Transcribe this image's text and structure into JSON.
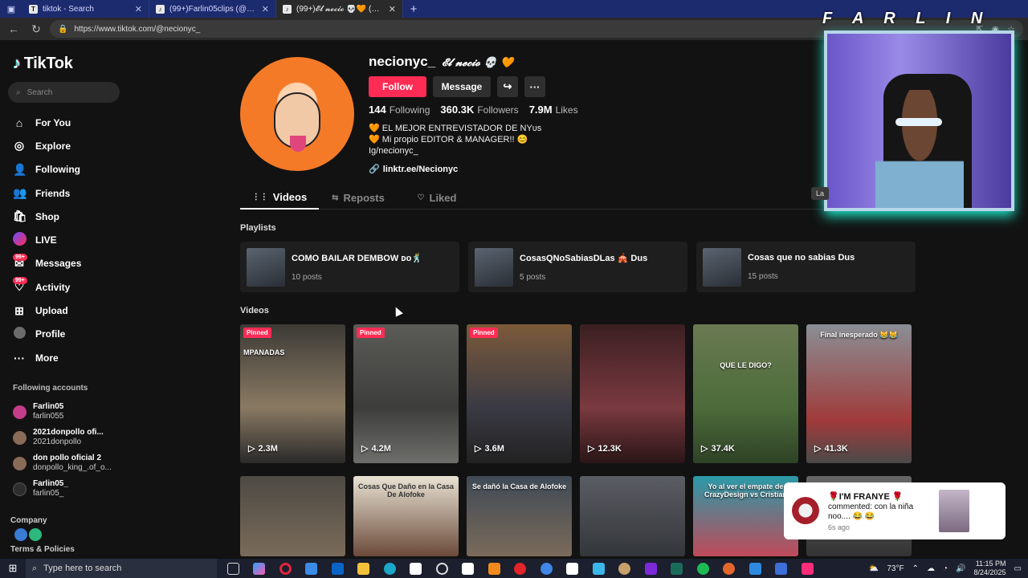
{
  "browser": {
    "tabs": [
      {
        "title": "tiktok - Search",
        "icon": "T",
        "active": false
      },
      {
        "title": "(99+)Farlin05clips (@farlin05clips)",
        "icon": "♪",
        "active": false
      },
      {
        "title": "(99+)𝓔𝓵 𝓷𝓮𝓬𝓲𝓸 💀🧡 (@necionyc_)",
        "icon": "♪",
        "active": true
      }
    ],
    "url": "https://www.tiktok.com/@necionyc_"
  },
  "sidebar": {
    "logo": "TikTok",
    "search_placeholder": "Search",
    "menu": [
      {
        "label": "For You",
        "icon": "home-icon",
        "glyph": "⌂"
      },
      {
        "label": "Explore",
        "icon": "compass-icon",
        "glyph": "◎"
      },
      {
        "label": "Following",
        "icon": "following-icon",
        "glyph": "👤"
      },
      {
        "label": "Friends",
        "icon": "friends-icon",
        "glyph": "👥"
      },
      {
        "label": "Shop",
        "icon": "shop-icon",
        "glyph": "🛍"
      },
      {
        "label": "LIVE",
        "icon": "live-icon",
        "glyph": ""
      },
      {
        "label": "Messages",
        "icon": "messages-icon",
        "glyph": "✉",
        "badge": "99+"
      },
      {
        "label": "Activity",
        "icon": "activity-icon",
        "glyph": "♡",
        "badge": "99+"
      },
      {
        "label": "Upload",
        "icon": "upload-icon",
        "glyph": "⊞"
      },
      {
        "label": "Profile",
        "icon": "profile-icon",
        "glyph": ""
      },
      {
        "label": "More",
        "icon": "more-icon",
        "glyph": "···"
      }
    ],
    "following_title": "Following accounts",
    "following": [
      {
        "name": "Farlin05",
        "handle": "farlin055"
      },
      {
        "name": "2021donpollo ofi...",
        "handle": "2021donpollo"
      },
      {
        "name": "don pollo oficial 2",
        "handle": "donpollo_king_.of_o..."
      },
      {
        "name": "Farlin05_",
        "handle": "farlin05_"
      }
    ],
    "company": "Company",
    "terms": "Terms & Policies"
  },
  "profile": {
    "username": "necionyc_",
    "nickname": "𝓔𝓵 𝓷𝓮𝓬𝓲𝓸 💀 🧡",
    "follow_label": "Follow",
    "message_label": "Message",
    "stats": [
      {
        "value": "144",
        "label": "Following"
      },
      {
        "value": "360.3K",
        "label": "Followers"
      },
      {
        "value": "7.9M",
        "label": "Likes"
      }
    ],
    "bio": [
      "🧡 EL MEJOR ENTREVISTADOR DE NYᴜs",
      "🧡 Mi propio EDITOR & MANAGER!! 😊",
      "Ig/necionyc_"
    ],
    "link": "linktr.ee/Necionyc",
    "tabs": [
      {
        "label": "Videos",
        "icon": "grid-icon",
        "glyph": "⋮⋮"
      },
      {
        "label": "Reposts",
        "icon": "repost-icon",
        "glyph": "⇆"
      },
      {
        "label": "Liked",
        "icon": "heart-icon",
        "glyph": "♡"
      }
    ]
  },
  "playlists_title": "Playlists",
  "playlists": [
    {
      "name": "COMO BAILAR DEMBOW ᴅᴏ🕺",
      "count": "10 posts"
    },
    {
      "name": "CosasQNoSabiasDLas 🎪 Dus",
      "count": "5 posts"
    },
    {
      "name": "Cosas que no sabias Dus",
      "count": "15 posts"
    }
  ],
  "videos_title": "Videos",
  "videos": [
    {
      "views": "2.3M",
      "pinned": "Pinned",
      "caption": "MPANADAS"
    },
    {
      "views": "4.2M",
      "pinned": "Pinned",
      "caption": ""
    },
    {
      "views": "3.6M",
      "pinned": "Pinned",
      "caption": ""
    },
    {
      "views": "12.3K",
      "pinned": "",
      "caption": ""
    },
    {
      "views": "37.4K",
      "pinned": "",
      "caption": "QUE LE DIGO?"
    },
    {
      "views": "41.3K",
      "pinned": "",
      "caption": "Final inesperado 😹😹"
    }
  ],
  "videos_row2": [
    {
      "caption": ""
    },
    {
      "caption": "Cosas Que Daño en la Casa De Alofoke"
    },
    {
      "caption": "Se dañó la Casa de Alofoke"
    },
    {
      "caption": ""
    },
    {
      "caption": "Yo al ver el empate de CrazyDesign vs Cristian"
    },
    {
      "caption": ""
    }
  ],
  "overlay": {
    "streamer_tag": "F A R L I N",
    "cam_label": "La"
  },
  "notification": {
    "name": "🌹I'M FRANYE 🌹",
    "body": "commented: con la niña noo.... 😂 😂",
    "time": "6s ago"
  },
  "taskbar": {
    "search_placeholder": "Type here to search",
    "weather": "73°F",
    "time": "11:15 PM",
    "date": "8/24/2025"
  }
}
